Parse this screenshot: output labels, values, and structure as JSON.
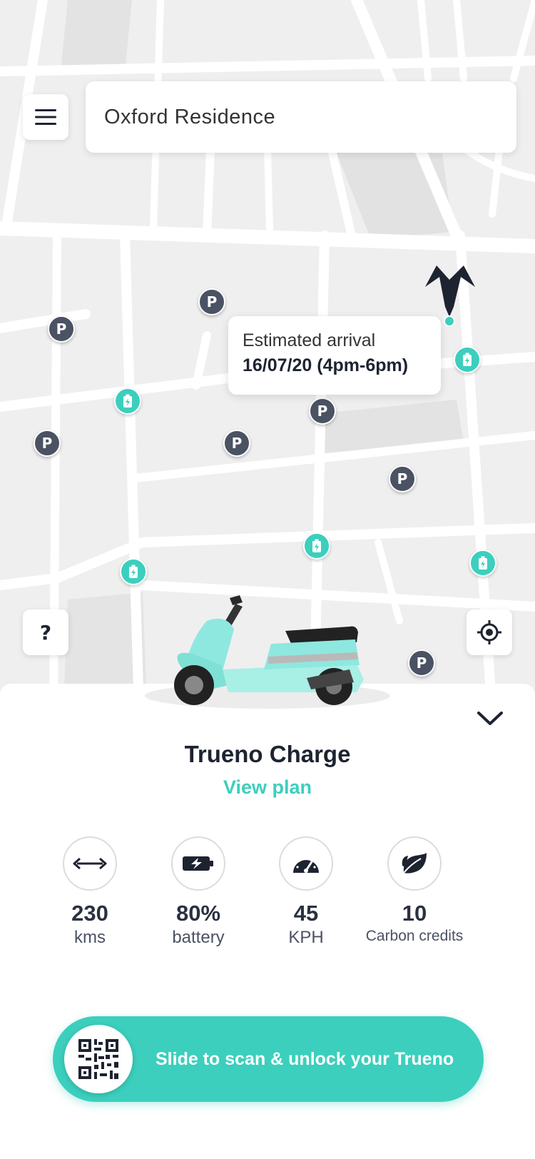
{
  "search": {
    "value": "Oxford Residence"
  },
  "tooltip": {
    "label": "Estimated arrival",
    "date": "16/07/20 (4pm-6pm)"
  },
  "help_button": {
    "label": "?"
  },
  "parking_pin_label": "P",
  "vehicle": {
    "name": "Trueno Charge",
    "plan_link": "View plan"
  },
  "stats": [
    {
      "icon": "range-arrows-icon",
      "value": "230",
      "unit": "kms"
    },
    {
      "icon": "battery-icon",
      "value": "80%",
      "unit": "battery"
    },
    {
      "icon": "speedometer-icon",
      "value": "45",
      "unit": "KPH"
    },
    {
      "icon": "leaf-icon",
      "value": "10",
      "unit": "Carbon credits"
    }
  ],
  "unlock": {
    "label": "Slide to scan & unlock your Trueno"
  },
  "colors": {
    "accent": "#3ccfbd",
    "pin_dark": "#4a5263",
    "text_dark": "#1d2330"
  }
}
